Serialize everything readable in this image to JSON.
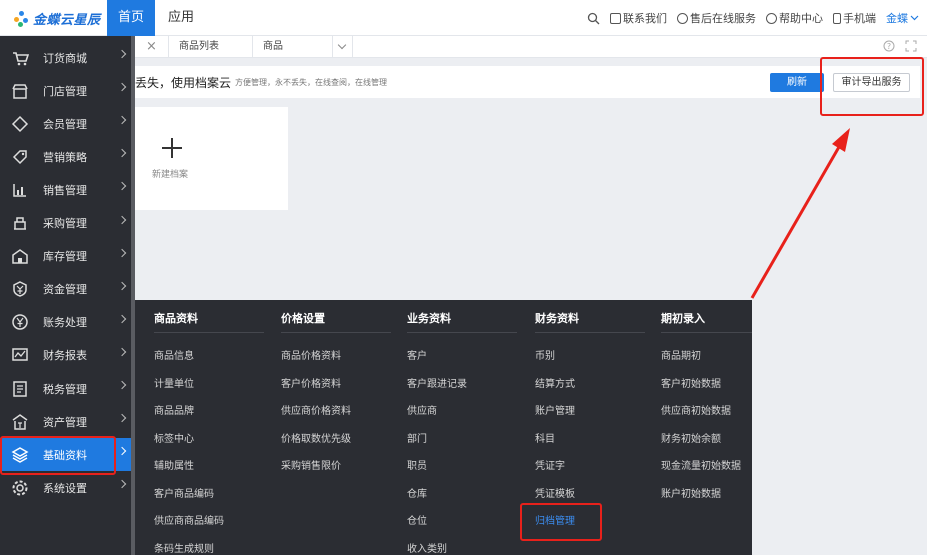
{
  "brand": {
    "name": "金蝶云星辰"
  },
  "topnav": {
    "home": "首页",
    "apps": "应用"
  },
  "topright": {
    "contact": "联系我们",
    "service": "售后在线服务",
    "help": "帮助中心",
    "mobile": "手机端",
    "user": "金蝶"
  },
  "sidebar": {
    "items": [
      {
        "label": "订货商城",
        "icon": "cart-icon"
      },
      {
        "label": "门店管理",
        "icon": "store-icon"
      },
      {
        "label": "会员管理",
        "icon": "diamond-icon"
      },
      {
        "label": "营销策略",
        "icon": "tag-icon"
      },
      {
        "label": "销售管理",
        "icon": "bar-chart-icon"
      },
      {
        "label": "采购管理",
        "icon": "purchase-icon"
      },
      {
        "label": "库存管理",
        "icon": "warehouse-icon"
      },
      {
        "label": "资金管理",
        "icon": "yuan-shield-icon"
      },
      {
        "label": "账务处理",
        "icon": "yuan-circle-icon"
      },
      {
        "label": "财务报表",
        "icon": "line-chart-icon"
      },
      {
        "label": "税务管理",
        "icon": "tax-icon"
      },
      {
        "label": "资产管理",
        "icon": "asset-icon"
      },
      {
        "label": "基础资料",
        "icon": "layers-icon"
      },
      {
        "label": "系统设置",
        "icon": "gear-icon"
      }
    ]
  },
  "tabs": {
    "close": "×",
    "list": "商品列表",
    "current": "商品"
  },
  "banner": {
    "main": "丢失，使用档案云",
    "sub": "方便管理，永不丢失，在线查阅，在线管理",
    "refresh": "刷新",
    "audit": "审计导出服务"
  },
  "card": {
    "new_label": "新建档案"
  },
  "mega": {
    "columns": [
      {
        "title": "商品资料",
        "items": [
          "商品信息",
          "计量单位",
          "商品品牌",
          "标签中心",
          "辅助属性",
          "客户商品编码",
          "供应商商品编码",
          "条码生成规则"
        ]
      },
      {
        "title": "价格设置",
        "items": [
          "商品价格资料",
          "客户价格资料",
          "供应商价格资料",
          "价格取数优先级",
          "采购销售限价"
        ]
      },
      {
        "title": "业务资料",
        "items": [
          "客户",
          "客户跟进记录",
          "供应商",
          "部门",
          "职员",
          "仓库",
          "仓位",
          "收入类别"
        ]
      },
      {
        "title": "财务资料",
        "items": [
          "币别",
          "结算方式",
          "账户管理",
          "科目",
          "凭证字",
          "凭证模板",
          "归档管理"
        ]
      },
      {
        "title": "期初录入",
        "items": [
          "商品期初",
          "客户初始数据",
          "供应商初始数据",
          "财务初始余额",
          "现金流量初始数据",
          "账户初始数据"
        ]
      }
    ]
  },
  "colors": {
    "accent": "#1f7ae0",
    "sidebar_bg": "#2b2d33",
    "annotation": "#e8211b",
    "link": "#3b8df0"
  }
}
